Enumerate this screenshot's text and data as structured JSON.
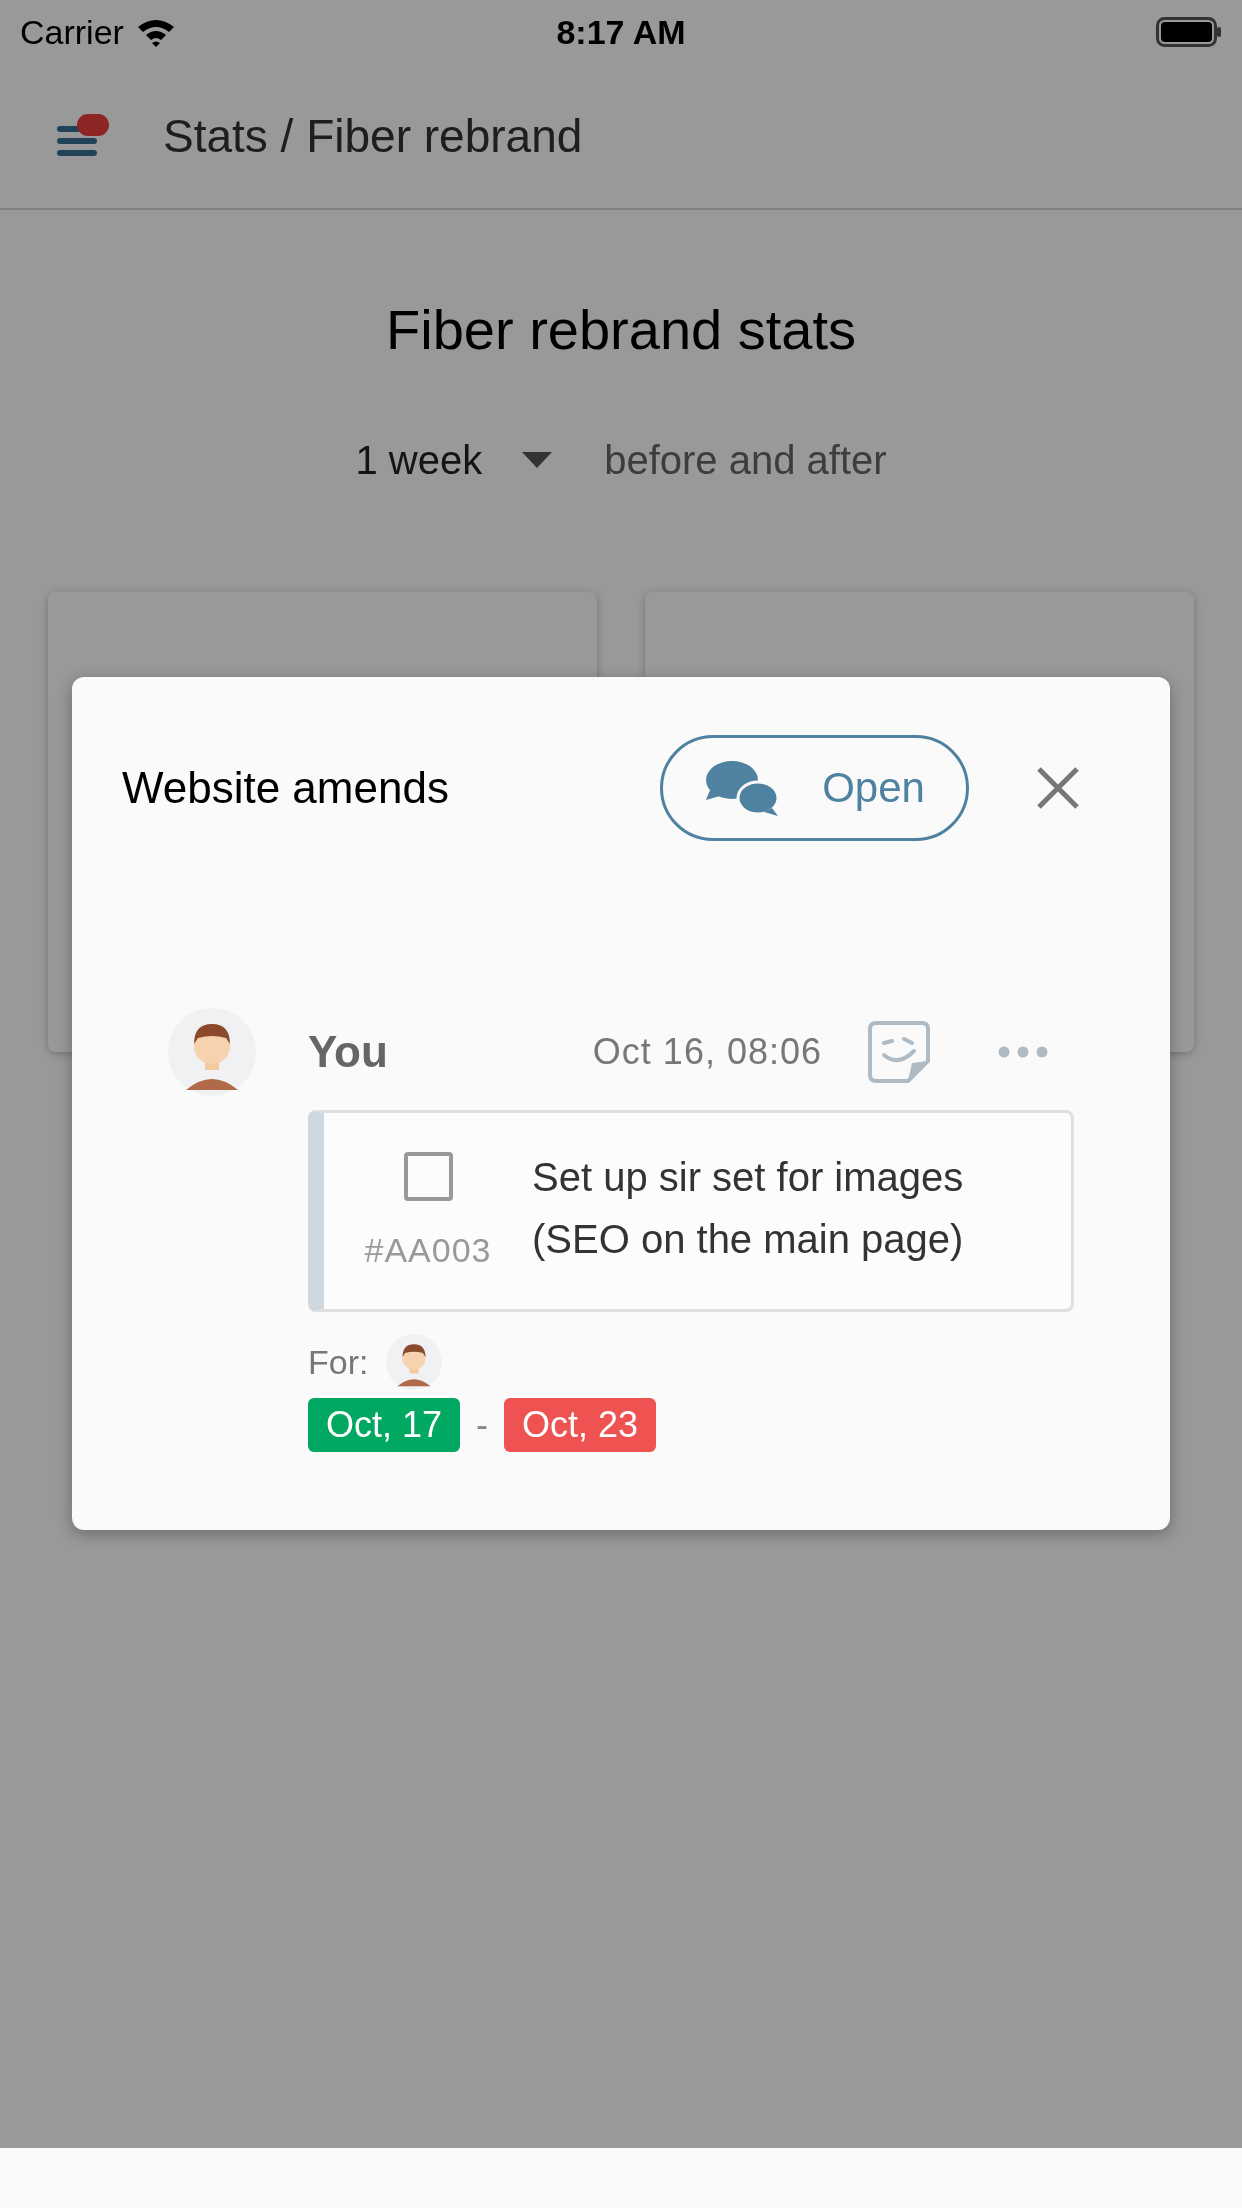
{
  "status_bar": {
    "carrier": "Carrier",
    "time": "8:17 AM"
  },
  "nav": {
    "title": "Stats / Fiber rebrand"
  },
  "page": {
    "title": "Fiber rebrand stats",
    "period": "1 week",
    "period_suffix": "before and after"
  },
  "modal": {
    "title": "Website amends",
    "open_button": "Open",
    "comment": {
      "author": "You",
      "time": "Oct 16, 08:06",
      "task": {
        "checked": false,
        "code": "#AA003",
        "text": "Set up sir set for images (SEO on the main page)"
      },
      "for_label": "For:",
      "start_date": "Oct, 17",
      "separator": "-",
      "end_date": "Oct, 23"
    }
  }
}
